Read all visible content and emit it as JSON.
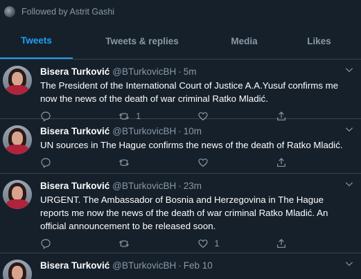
{
  "followed_by": "Followed by Astrit Gashi",
  "tabs": [
    {
      "label": "Tweets",
      "active": true
    },
    {
      "label": "Tweets & replies",
      "active": false
    },
    {
      "label": "Media",
      "active": false
    },
    {
      "label": "Likes",
      "active": false
    }
  ],
  "tweets": [
    {
      "name": "Bisera Turković",
      "handle": "@BTurkovicBH",
      "time": "5m",
      "text": "The President of the International Court of Justice A.A.Yusuf confirms me now the news of the death of war criminal Ratko Mladić.",
      "replies": "",
      "retweets": "1",
      "likes": ""
    },
    {
      "name": "Bisera Turković",
      "handle": "@BTurkovicBH",
      "time": "10m",
      "text": "UN sources in The Hague confirms the news of the death of Ratko Mladić.",
      "replies": "",
      "retweets": "",
      "likes": ""
    },
    {
      "name": "Bisera Turković",
      "handle": "@BTurkovicBH",
      "time": "23m",
      "text": "URGENT. The Ambassador of Bosnia and Herzegovina in The Hague reports me now the news of the death of war criminal Ratko Mladić. An official announcement to be released soon.",
      "replies": "",
      "retweets": "",
      "likes": "1"
    },
    {
      "name": "Bisera Turković",
      "handle": "@BTurkovicBH",
      "time": "Feb 10",
      "text": "",
      "replies": "",
      "retweets": "",
      "likes": ""
    }
  ],
  "separator": "·",
  "colors": {
    "background": "#15202b",
    "accent": "#1da1f2",
    "muted": "#8899a6",
    "border": "#38444d"
  }
}
